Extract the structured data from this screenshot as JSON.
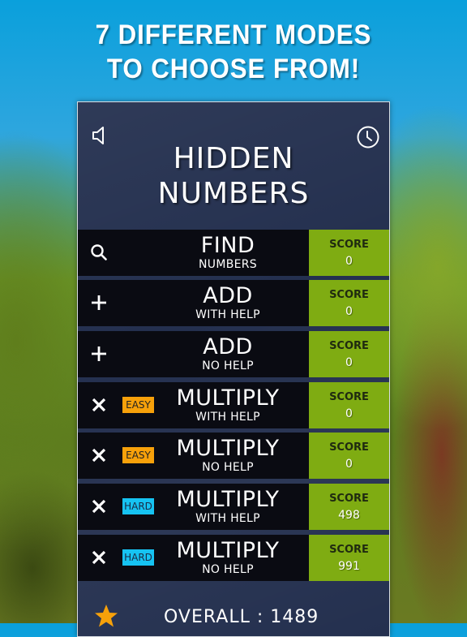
{
  "headline": {
    "line1": "7 DIFFERENT MODES",
    "line2": "TO CHOOSE FROM!"
  },
  "app": {
    "title_line1": "HIDDEN",
    "title_line2": "NUMBERS",
    "sound_icon": "speaker-icon",
    "timer_icon": "clock-icon"
  },
  "modes": [
    {
      "icon": "search-icon",
      "badge": "",
      "name": "FIND",
      "sub": "NUMBERS",
      "score_label": "SCORE",
      "score": "0"
    },
    {
      "icon": "plus-icon",
      "badge": "",
      "name": "ADD",
      "sub": "WITH HELP",
      "score_label": "SCORE",
      "score": "0"
    },
    {
      "icon": "plus-icon",
      "badge": "",
      "name": "ADD",
      "sub": "NO HELP",
      "score_label": "SCORE",
      "score": "0"
    },
    {
      "icon": "multiply-icon",
      "badge": "EASY",
      "name": "MULTIPLY",
      "sub": "WITH HELP",
      "score_label": "SCORE",
      "score": "0"
    },
    {
      "icon": "multiply-icon",
      "badge": "EASY",
      "name": "MULTIPLY",
      "sub": "NO HELP",
      "score_label": "SCORE",
      "score": "0"
    },
    {
      "icon": "multiply-icon",
      "badge": "HARD",
      "name": "MULTIPLY",
      "sub": "WITH HELP",
      "score_label": "SCORE",
      "score": "498"
    },
    {
      "icon": "multiply-icon",
      "badge": "HARD",
      "name": "MULTIPLY",
      "sub": "NO HELP",
      "score_label": "SCORE",
      "score": "991"
    }
  ],
  "overall": {
    "text": "OVERALL : 1489",
    "icon": "star-icon"
  },
  "colors": {
    "panel": "#24304f",
    "row": "#0a0b12",
    "score_bg": "#7fac12",
    "easy": "#f7a10a",
    "hard": "#16c3f2",
    "star": "#f7a10a"
  }
}
